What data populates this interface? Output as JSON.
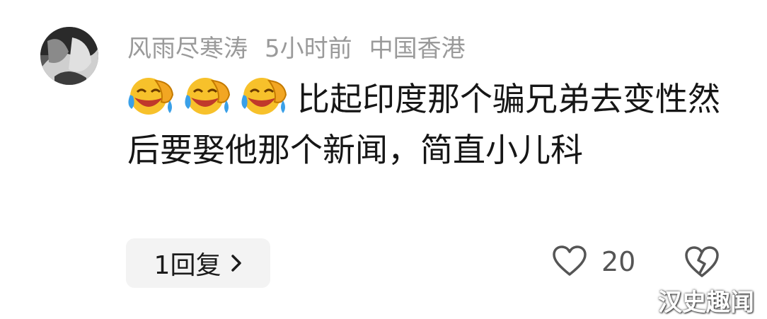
{
  "comment": {
    "username": "风雨尽寒涛",
    "time": "5小时前",
    "location": "中国香港",
    "emojis": [
      "face-with-tears-of-joy-icon",
      "face-with-tears-of-joy-icon",
      "face-with-tears-of-joy-icon"
    ],
    "text": "比起印度那个骗兄弟去变性然后要娶他那个新闻，简直小儿科"
  },
  "actions": {
    "reply_label": "1回复",
    "like_count": "20"
  },
  "watermark": "汉史趣闻",
  "colors": {
    "meta_text": "#9a9a9a",
    "body_text": "#161616",
    "reply_bg": "#f3f3f3",
    "emoji_yellow": "#f7c12b",
    "emoji_tear": "#3aa0e8"
  }
}
